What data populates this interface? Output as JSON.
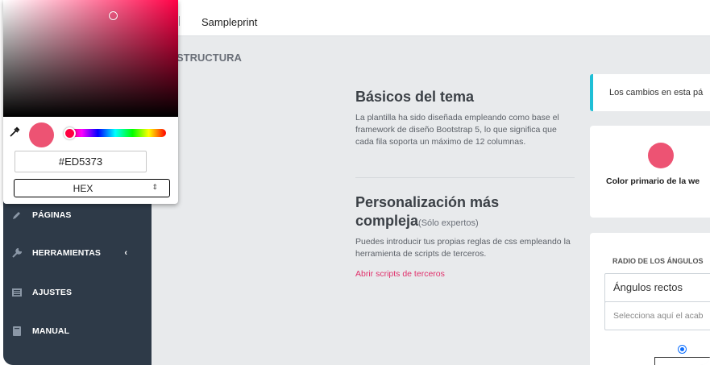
{
  "topbar": {
    "site_name": "Sampleprint"
  },
  "section_title": "STRUCTURA",
  "sidebar": {
    "items": [
      {
        "label": "PÁGINAS",
        "icon": "pencil-icon"
      },
      {
        "label": "HERRAMIENTAS",
        "icon": "wrench-icon",
        "chevron": "‹"
      },
      {
        "label": "AJUSTES",
        "icon": "list-icon"
      },
      {
        "label": "MANUAL",
        "icon": "book-icon"
      }
    ]
  },
  "main": {
    "basics": {
      "title": "Básicos del tema",
      "text": "La plantilla ha sido diseñada empleando como base el framework de diseño Bootstrap 5, lo que significa que cada fila soporta un máximo de 12 columnas."
    },
    "custom": {
      "title": "Personalización más compleja",
      "title_suffix": "(Sólo expertos)",
      "text": "Puedes introducir tus propias reglas de css empleando la herramienta de scripts de terceros.",
      "link": "Abrir scripts de terceros"
    }
  },
  "right": {
    "alert_text": "Los cambios en esta pá",
    "primary_color_label": "Color primario de la we",
    "corners": {
      "header": "RADIO DE LOS ÁNGULOS",
      "selected": "Ángulos rectos",
      "placeholder": "Selecciona aquí el acab"
    }
  },
  "picker": {
    "hex_value": "#ED5373",
    "format": "HEX",
    "color": "#ed5373"
  },
  "colors": {
    "sidebar_bg": "#2e3a48",
    "accent": "#e0306b",
    "info": "#1fbfd6"
  }
}
